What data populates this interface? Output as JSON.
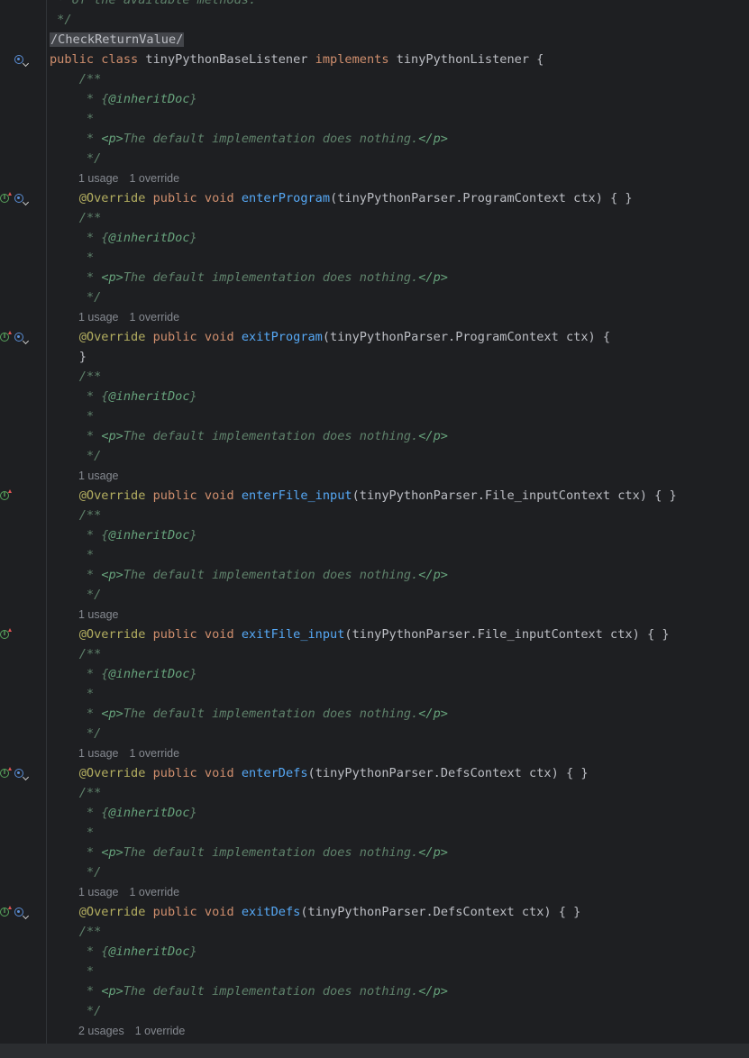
{
  "editor": {
    "top_comment_partial": " * of the available methods.",
    "top_comment_end": " */",
    "annotation_check": "/CheckReturnValue/",
    "class_decl": {
      "public": "public",
      "class": "class",
      "name": "tinyPythonBaseListener",
      "implements": "implements",
      "iface": "tinyPythonListener {"
    },
    "javadoc": {
      "open": "/**",
      "inherit": "@inheritDoc",
      "star": " *",
      "p_open": "<p>",
      "p_text": "The default implementation does nothing.",
      "p_close": "</p>",
      "close": " */"
    },
    "tokens": {
      "override": "@Override",
      "public": "public",
      "void": "void"
    },
    "methods": [
      {
        "hint_usage": "1 usage",
        "hint_override": "1 override",
        "name": "enterProgram",
        "params": "(tinyPythonParser.ProgramContext ctx) { }",
        "icons": [
          "implements-icon",
          "overridden-icon"
        ]
      },
      {
        "hint_usage": "1 usage",
        "hint_override": "1 override",
        "name": "exitProgram",
        "params": "(tinyPythonParser.ProgramContext ctx) {",
        "close": "}",
        "icons": [
          "implements-icon",
          "overridden-icon"
        ]
      },
      {
        "hint_usage": "1 usage",
        "hint_override": "",
        "name": "enterFile_input",
        "params": "(tinyPythonParser.File_inputContext ctx) { }",
        "icons": [
          "implements-icon"
        ]
      },
      {
        "hint_usage": "1 usage",
        "hint_override": "",
        "name": "exitFile_input",
        "params": "(tinyPythonParser.File_inputContext ctx) { }",
        "icons": [
          "implements-icon"
        ]
      },
      {
        "hint_usage": "1 usage",
        "hint_override": "1 override",
        "name": "enterDefs",
        "params": "(tinyPythonParser.DefsContext ctx) { }",
        "icons": [
          "implements-icon",
          "overridden-icon"
        ]
      },
      {
        "hint_usage": "1 usage",
        "hint_override": "1 override",
        "name": "exitDefs",
        "params": "(tinyPythonParser.DefsContext ctx) { }",
        "icons": [
          "implements-icon",
          "overridden-icon"
        ]
      }
    ],
    "last_hint_usage": "2 usages",
    "last_hint_override": "1 override"
  },
  "colors": {
    "background": "#1e1f22",
    "keyword": "#cf8e6d",
    "annotation": "#b3ae60",
    "function": "#56a8f5",
    "doc_comment": "#5f826b",
    "text": "#bcbec4",
    "hint": "#868a91"
  }
}
